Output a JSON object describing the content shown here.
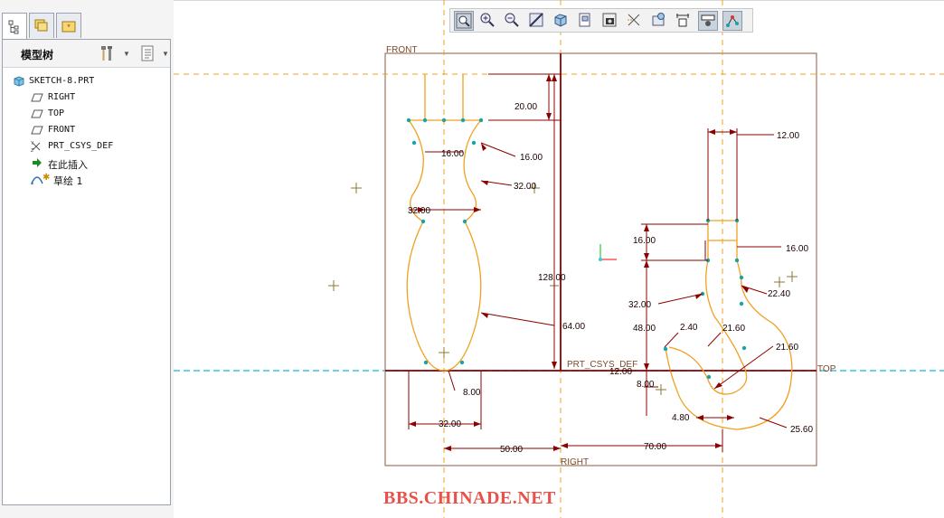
{
  "panel": {
    "tabs": [
      {
        "icon": "model-tree-tab-icon"
      },
      {
        "icon": "folder-browser-tab-icon"
      },
      {
        "icon": "favorites-tab-icon"
      }
    ],
    "title": "模型树",
    "settings_icon": "tools-icon",
    "show_icon": "list-settings-icon",
    "tree": [
      {
        "label": "SKETCH-8.PRT",
        "icon": "part-icon"
      },
      {
        "label": "RIGHT",
        "icon": "datum-plane-icon"
      },
      {
        "label": "TOP",
        "icon": "datum-plane-icon"
      },
      {
        "label": "FRONT",
        "icon": "datum-plane-icon"
      },
      {
        "label": "PRT_CSYS_DEF",
        "icon": "csys-icon"
      },
      {
        "label": "在此插入",
        "icon": "insert-here-arrow-icon"
      },
      {
        "label": "草绘 1",
        "icon": "sketch-icon"
      }
    ]
  },
  "toolbar": {
    "buttons": [
      {
        "icon": "refit-icon"
      },
      {
        "icon": "zoom-in-icon"
      },
      {
        "icon": "zoom-out-icon"
      },
      {
        "icon": "repaint-icon"
      },
      {
        "icon": "display-style-icon"
      },
      {
        "icon": "saved-views-icon"
      },
      {
        "icon": "view-manager-icon"
      },
      {
        "icon": "datum-display-icon"
      },
      {
        "icon": "spin-center-icon"
      },
      {
        "icon": "sketch-dimensions-icon"
      },
      {
        "icon": "sketch-constraints-icon"
      },
      {
        "icon": "sketch-vertices-icon"
      }
    ]
  },
  "drawing": {
    "datum_labels": {
      "front": "FRONT",
      "top": "TOP",
      "right": "RIGHT",
      "csys": "PRT_CSYS_DEF"
    },
    "dimensions": [
      "20.00",
      "16.00",
      "16.00",
      "32.00",
      "32.00",
      "128.00",
      "64.00",
      "8.00",
      "32.00",
      "50.00",
      "12.00",
      "16.00",
      "16.00",
      "22.40",
      "32.00",
      "48.00",
      "2.40",
      "21.60",
      "21.60",
      "12.00",
      "8.00",
      "4.80",
      "25.60",
      "70.00"
    ],
    "colors": {
      "dimension": "#8b0000",
      "sketch": "#f0a020",
      "datum": "#f0a020",
      "top_datum": "#3cc4e0",
      "vertex": "#1aa3a3",
      "frame": "#8b5a3c"
    }
  },
  "watermark": "BBS.CHINADE.NET"
}
